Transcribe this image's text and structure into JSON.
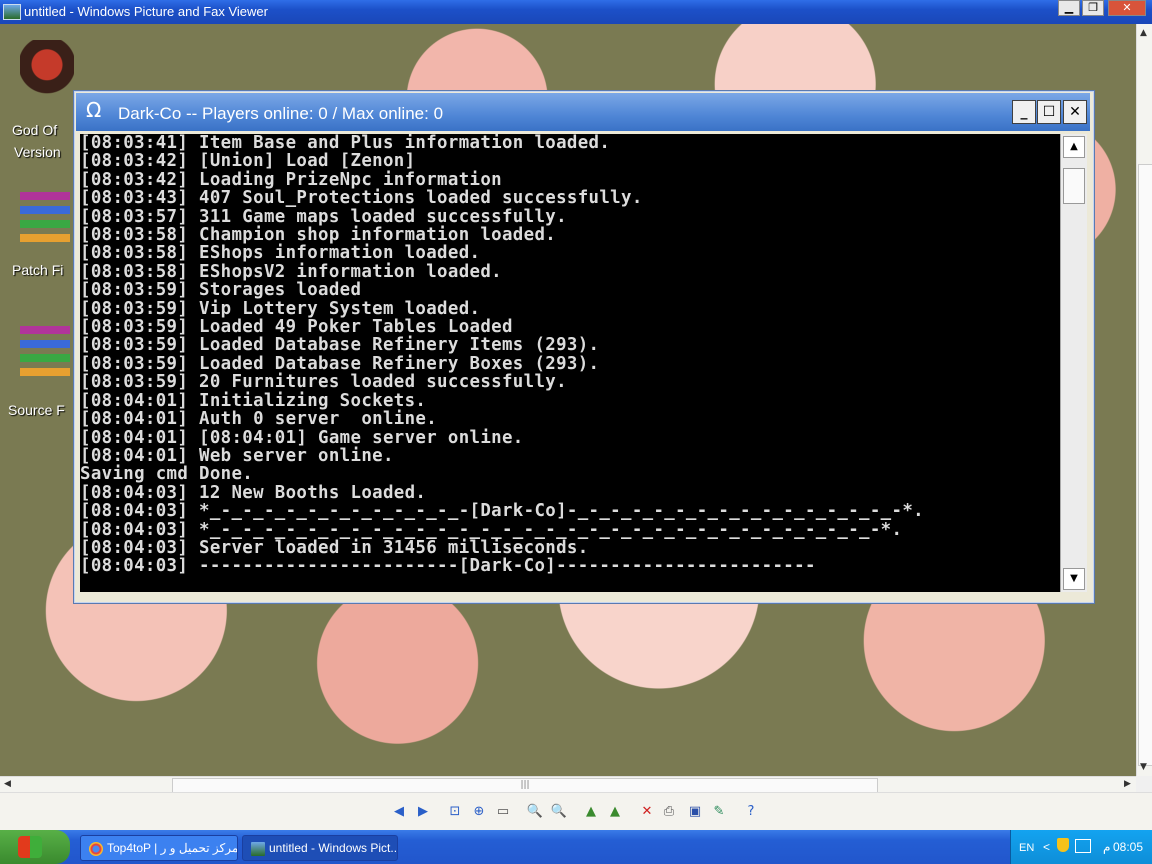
{
  "outer_window": {
    "title": "untitled - Windows Picture and Fax Viewer",
    "min_glyph": "▁",
    "max_glyph": "❐",
    "close_glyph": "✕"
  },
  "desktop_icons": [
    {
      "label": "God Of",
      "label2": "Version"
    },
    {
      "label": "Patch Fi"
    },
    {
      "label": "Source F"
    }
  ],
  "console_window": {
    "omega": "Ω",
    "title": "Dark-Co -- Players online: 0 / Max online: 0",
    "min_glyph": "_",
    "max_glyph": "☐",
    "close_glyph": "✕",
    "scroll_up": "▲",
    "scroll_down": "▼",
    "lines": [
      "[08:03:41] Item Base and Plus information loaded.",
      "[08:03:42] [Union] Load [Zenon]",
      "[08:03:42] Loading PrizeNpc information",
      "[08:03:43] 407 Soul_Protections loaded successfully.",
      "[08:03:57] 311 Game maps loaded successfully.",
      "[08:03:58] Champion shop information loaded.",
      "[08:03:58] EShops information loaded.",
      "[08:03:58] EShopsV2 information loaded.",
      "[08:03:59] Storages loaded",
      "[08:03:59] Vip Lottery System loaded.",
      "[08:03:59] Loaded 49 Poker Tables Loaded",
      "[08:03:59] Loaded Database Refinery Items (293).",
      "[08:03:59] Loaded Database Refinery Boxes (293).",
      "[08:03:59] 20 Furnitures loaded successfully.",
      "[08:04:01] Initializing Sockets.",
      "[08:04:01] Auth 0 server  online.",
      "[08:04:01] [08:04:01] Game server online.",
      "[08:04:01] Web server online.",
      "Saving cmd Done.",
      "[08:04:03] 12 New Booths Loaded.",
      "[08:04:03] *_-_-_-_-_-_-_-_-_-_-_-_-[Dark-Co]-_-_-_-_-_-_-_-_-_-_-_-_-_-_-_-*.",
      "[08:04:03] *_-_-_-_-_-_-_-_-_-_-_-_-_-_-_-_-_-_-_-_-_-_-_-_-_-_-_-_-_-_-_-*.",
      "[08:04:03] Server loaded in 31456 milliseconds.",
      "[08:04:03] ------------------------[Dark-Co]------------------------"
    ]
  },
  "viewer_toolbar": {
    "buttons": [
      {
        "name": "previous-image-icon",
        "glyph": "◀",
        "color": "#2a5fc8"
      },
      {
        "name": "next-image-icon",
        "glyph": "▶",
        "color": "#2a5fc8"
      },
      {
        "name": "best-fit-icon",
        "glyph": "⊡",
        "color": "#2a5fc8"
      },
      {
        "name": "actual-size-icon",
        "glyph": "⊕",
        "color": "#2a5fc8"
      },
      {
        "name": "slideshow-icon",
        "glyph": "▭",
        "color": "#555555"
      },
      {
        "name": "zoom-in-icon",
        "glyph": "🔍",
        "color": "#2a5fc8"
      },
      {
        "name": "zoom-out-icon",
        "glyph": "🔍",
        "color": "#2a5fc8"
      },
      {
        "name": "rotate-clockwise-icon",
        "glyph": "▲",
        "color": "#3a8a2e"
      },
      {
        "name": "rotate-counterclockwise-icon",
        "glyph": "▲",
        "color": "#3a8a2e"
      },
      {
        "name": "delete-icon",
        "glyph": "✕",
        "color": "#d02020"
      },
      {
        "name": "print-icon",
        "glyph": "⎙",
        "color": "#555555"
      },
      {
        "name": "save-icon",
        "glyph": "▣",
        "color": "#2a4fa8"
      },
      {
        "name": "edit-icon",
        "glyph": "✎",
        "color": "#2a8a5a"
      },
      {
        "name": "help-icon",
        "glyph": "?",
        "color": "#2a5fc8"
      }
    ]
  },
  "taskbar": {
    "tasks": [
      {
        "label": "Top4toP | مركز تحميل و ر...",
        "active": false
      },
      {
        "label": "untitled - Windows Pict...",
        "active": true
      }
    ],
    "tray": {
      "lang": "EN",
      "arrow": "<",
      "clock": "08:05",
      "ampm": "م"
    }
  }
}
